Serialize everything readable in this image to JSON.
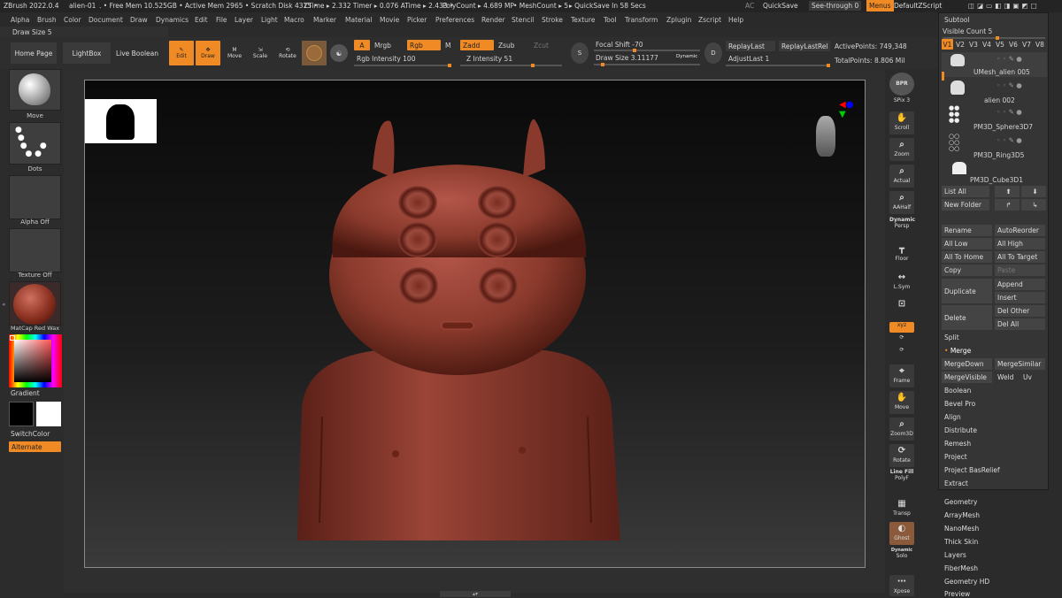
{
  "topbar": {
    "items": [
      "ZBrush 2022.0.4",
      "alien-01",
      ". • Free Mem 10.525GB • Active Mem 2965 • Scratch Disk 4315 •",
      "ZTime ▸ 2.332 Timer ▸ 0.076 ATime ▸ 2.433 •",
      "PolyCount ▸ 4.689 MP",
      "• MeshCount ▸ 5",
      "▸ QuickSave In 58 Secs",
      "AC",
      "QuickSave",
      "See-through  0",
      "Menus",
      "DefaultZScript"
    ]
  },
  "menus": [
    "Alpha",
    "Brush",
    "Color",
    "Document",
    "Draw",
    "Dynamics",
    "Edit",
    "File",
    "Layer",
    "Light",
    "Macro",
    "Marker",
    "Material",
    "Movie",
    "Picker",
    "Preferences",
    "Render",
    "Stencil",
    "Stroke",
    "Texture",
    "Tool",
    "Transform",
    "Zplugin",
    "Zscript",
    "Help"
  ],
  "brush_info": "Draw Size 5",
  "toolbar": {
    "home": "Home Page",
    "lightbox": "LightBox",
    "live_boolean": "Live Boolean",
    "edit": "Edit",
    "draw": "Draw",
    "move": "Move",
    "scale": "Scale",
    "rotate": "Rotate",
    "a": "A",
    "mrgb": "Mrgb",
    "rgb": "Rgb",
    "m": "M",
    "zadd": "Zadd",
    "zsub": "Zsub",
    "zcut": "Zcut",
    "rgb_intensity": "Rgb Intensity 100",
    "z_intensity": "Z Intensity 51",
    "focal_shift": "Focal Shift -70",
    "draw_size": "Draw Size 3.11177",
    "dynamic": "Dynamic",
    "replay_last": "ReplayLast",
    "replay_last_rel": "ReplayLastRel",
    "adjust_last": "AdjustLast 1",
    "active_points": "ActivePoints: 749,348",
    "total_points": "TotalPoints: 8.806 Mil"
  },
  "left": {
    "brush": "Move",
    "stroke": "Dots",
    "alpha": "Alpha Off",
    "texture": "Texture Off",
    "material": "MatCap Red Wax",
    "gradient": "Gradient",
    "switch_color": "SwitchColor",
    "alternate": "Alternate"
  },
  "shelf": [
    {
      "icon": "BPR",
      "label": "BPR"
    },
    {
      "icon": "SPix 3",
      "label": ""
    },
    {
      "icon": "✋",
      "label": "Scroll"
    },
    {
      "icon": "🔍",
      "label": "Zoom"
    },
    {
      "icon": "🔍",
      "label": "Actual"
    },
    {
      "icon": "🔍",
      "label": "AAHalf"
    },
    {
      "icon": "Dynamic",
      "label": "Persp"
    },
    {
      "icon": "━",
      "label": "Floor"
    },
    {
      "icon": "↔",
      "label": "L.Sym"
    },
    {
      "icon": "🔒",
      "label": ""
    },
    {
      "icon": "xyz",
      "label": ""
    },
    {
      "icon": "⟳",
      "label": ""
    },
    {
      "icon": "⟳",
      "label": ""
    },
    {
      "icon": "⌖",
      "label": "Frame"
    },
    {
      "icon": "✋",
      "label": "Move"
    },
    {
      "icon": "🔍",
      "label": "Zoom3D"
    },
    {
      "icon": "⟳",
      "label": "Rotate"
    },
    {
      "icon": "Line Fill",
      "label": "PolyF"
    },
    {
      "icon": "▦",
      "label": "Transp"
    },
    {
      "icon": "◐",
      "label": "Ghost"
    },
    {
      "icon": "Dynamic",
      "label": "Solo"
    },
    {
      "icon": "⋯",
      "label": "Xpose"
    }
  ],
  "subtool": {
    "title": "Subtool",
    "visible_count": "Visible Count 5",
    "tabs": [
      "V1",
      "V2",
      "V3",
      "V4",
      "V5",
      "V6",
      "V7",
      "V8"
    ],
    "items": [
      "UMesh_alien 005",
      "alien 002",
      "PM3D_Sphere3D7",
      "PM3D_Ring3D5",
      "PM3D_Cube3D1"
    ],
    "list_all": "List All",
    "new_folder": "New Folder",
    "rename": "Rename",
    "autoreorder": "AutoReorder",
    "all_low": "All Low",
    "all_high": "All High",
    "all_to_home": "All To Home",
    "all_to_target": "All To Target",
    "copy": "Copy",
    "paste": "Paste",
    "duplicate": "Duplicate",
    "append": "Append",
    "insert": "Insert",
    "delete": "Delete",
    "del_other": "Del Other",
    "del_all": "Del All",
    "split": "Split",
    "merge": "Merge",
    "merge_down": "MergeDown",
    "merge_similar": "MergeSimilar",
    "merge_visible": "MergeVisible",
    "weld": "Weld",
    "uv": "Uv",
    "boolean": "Boolean",
    "bevel_pro": "Bevel Pro",
    "align": "Align",
    "distribute": "Distribute",
    "remesh": "Remesh",
    "project": "Project",
    "project_basrelief": "Project BasRelief",
    "extract": "Extract"
  },
  "tool_sections": [
    "Geometry",
    "ArrayMesh",
    "NanoMesh",
    "Thick Skin",
    "Layers",
    "FiberMesh",
    "Geometry HD",
    "Preview"
  ],
  "colors": {
    "accent": "#f08a24",
    "model": "#8a3a2c",
    "background": "#2b2b2b"
  }
}
